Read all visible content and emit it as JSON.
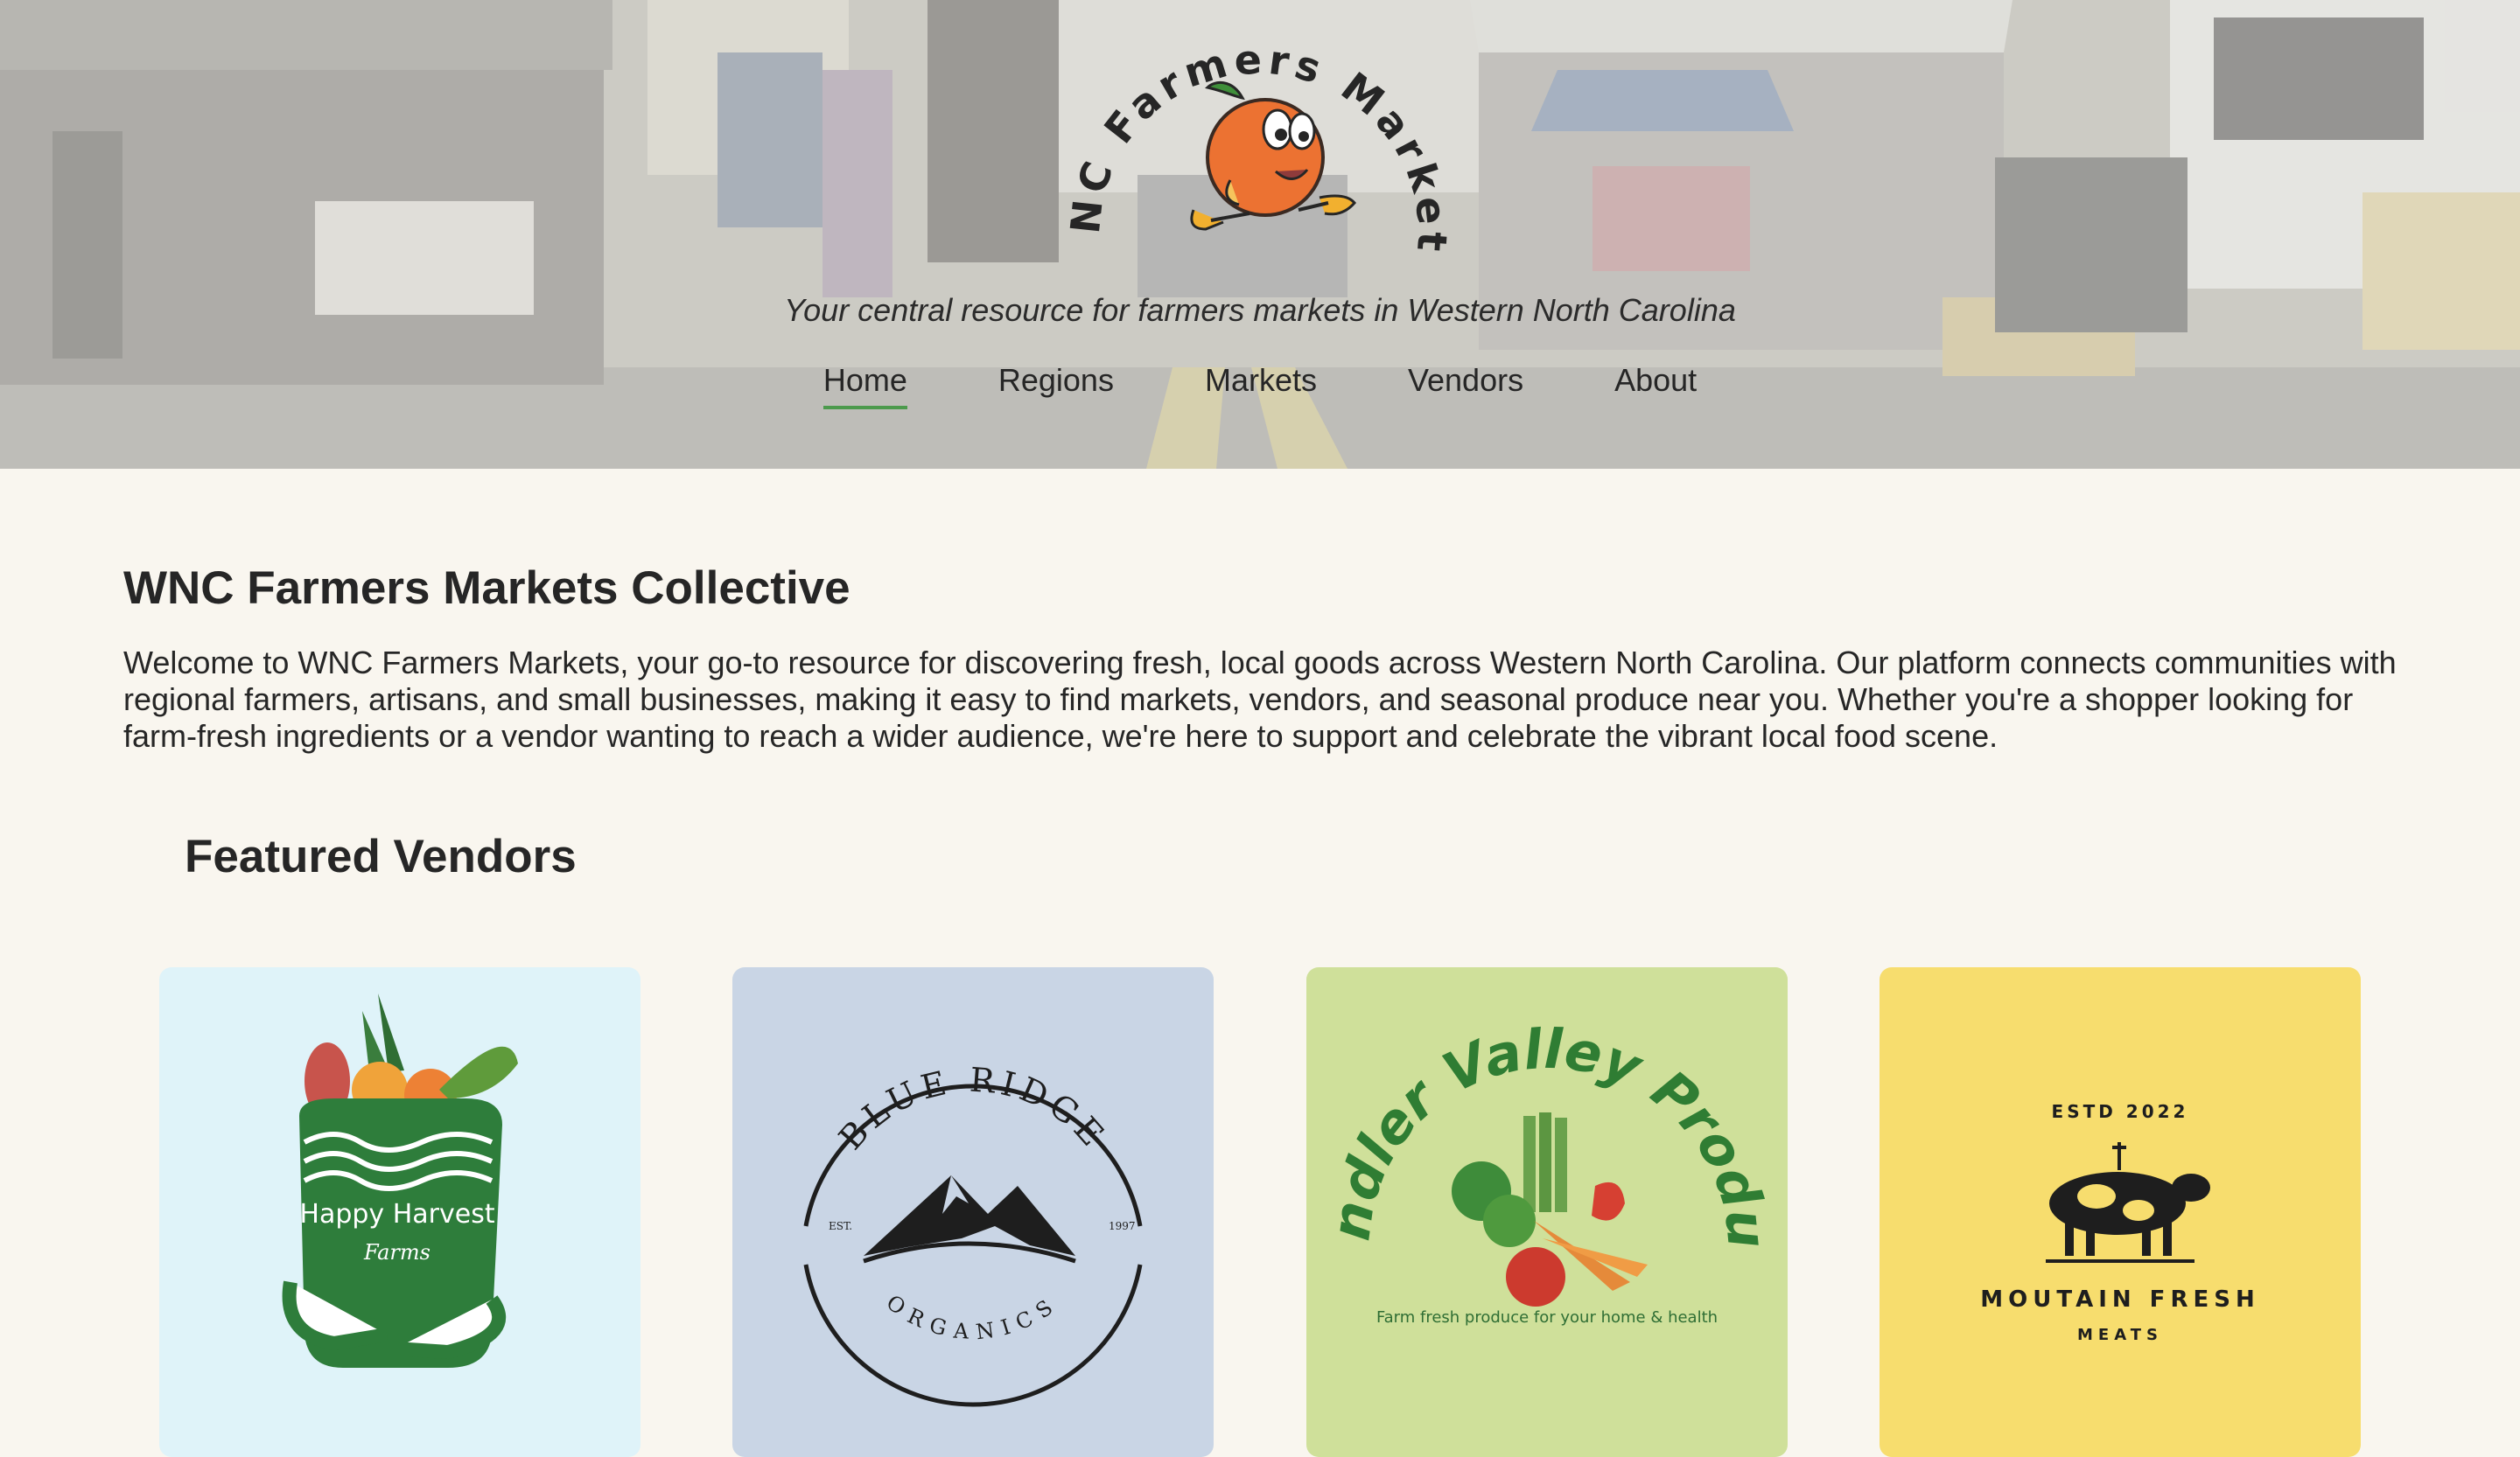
{
  "site": {
    "logo_text": "WNC Farmers Markets",
    "tagline": "Your central resource for farmers markets in Western North Carolina"
  },
  "nav": {
    "items": [
      "Home",
      "Regions",
      "Markets",
      "Vendors",
      "About"
    ],
    "active": "Home"
  },
  "main": {
    "title": "WNC Farmers Markets Collective",
    "intro": "Welcome to WNC Farmers Markets, your go-to resource for discovering fresh, local goods across Western North Carolina. Our platform connects communities with regional farmers, artisans, and small businesses, making it easy to find markets, vendors, and seasonal produce near you. Whether you're a shopper looking for farm-fresh ingredients or a vendor wanting to reach a wider audience, we're here to support and celebrate the vibrant local food scene."
  },
  "featured": {
    "title": "Featured Vendors",
    "vendors": [
      {
        "name": "Happy Harvest",
        "subtitle": "Farms",
        "bg": "#dff3f9"
      },
      {
        "name": "BLUE RIDGE",
        "subtitle": "ORGANICS",
        "est_label": "EST.",
        "est_year": "1997",
        "bg": "#c9d5e5"
      },
      {
        "name": "Candler Valley Produce",
        "subtitle": "Farm fresh produce for your home & health",
        "bg": "#cfe09a"
      },
      {
        "name": "MOUTAIN FRESH",
        "subtitle": "MEATS",
        "est": "ESTD 2022",
        "bg": "#f7dd6e"
      }
    ]
  }
}
